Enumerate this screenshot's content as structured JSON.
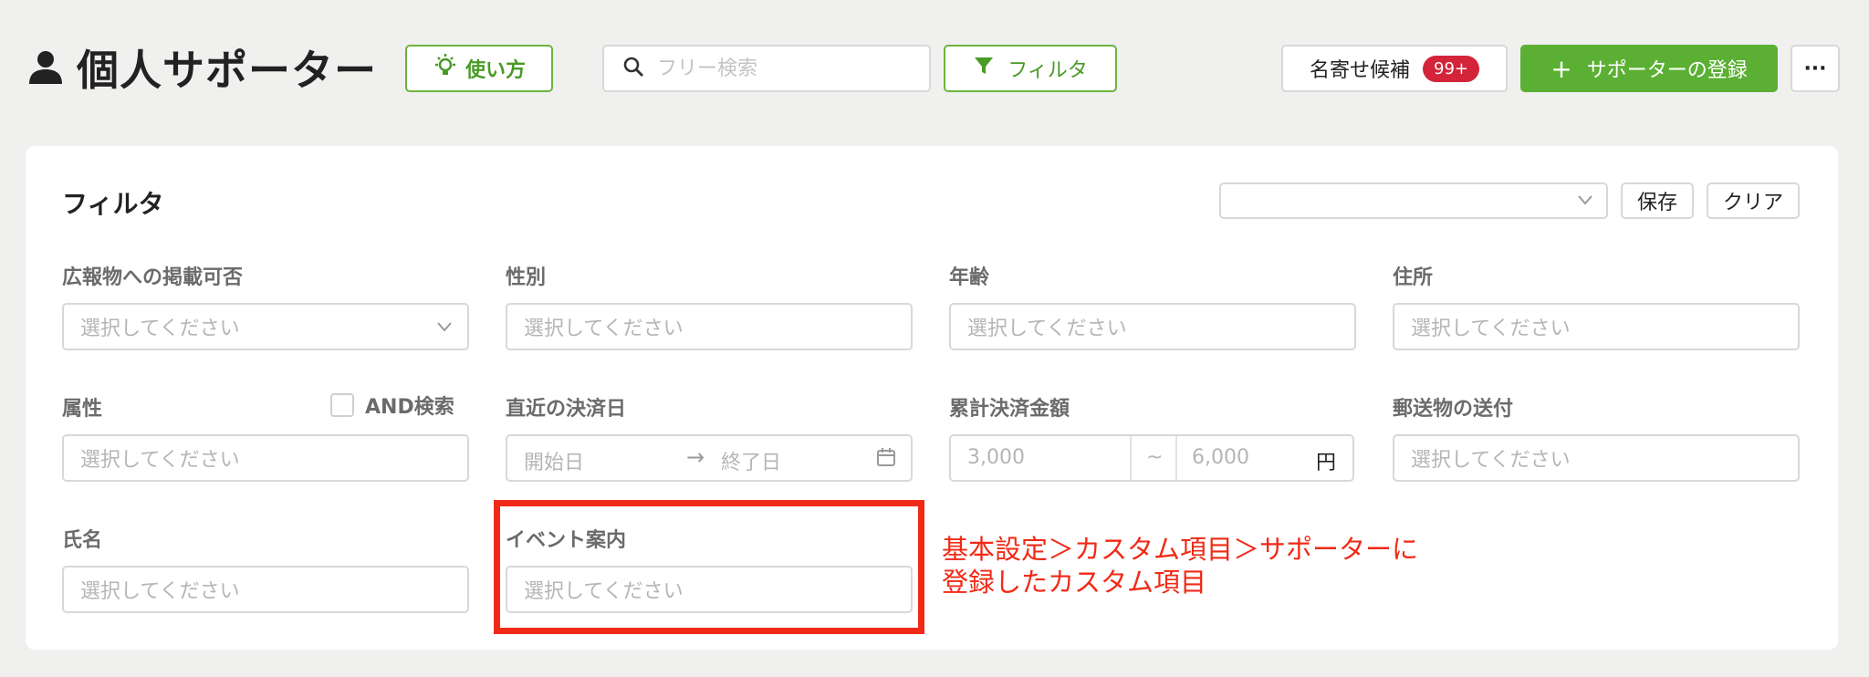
{
  "header": {
    "title": "個人サポーター",
    "howto_label": "使い方",
    "search_placeholder": "フリー検索",
    "filter_label": "フィルタ",
    "dedupe_label": "名寄せ候補",
    "dedupe_badge": "99+",
    "register_label": "サポーターの登録",
    "register_plus": "+",
    "more_label": "···"
  },
  "panel": {
    "title": "フィルタ",
    "preset_value": "",
    "save_label": "保存",
    "clear_label": "クリア"
  },
  "filters": {
    "pr_publish": {
      "label": "広報物への掲載可否",
      "placeholder": "選択してください"
    },
    "gender": {
      "label": "性別",
      "placeholder": "選択してください"
    },
    "age": {
      "label": "年齢",
      "placeholder": "選択してください"
    },
    "address": {
      "label": "住所",
      "placeholder": "選択してください"
    },
    "attribute": {
      "label": "属性",
      "placeholder": "選択してください",
      "and_label": "AND検索",
      "and_checked": false
    },
    "last_payment": {
      "label": "直近の決済日",
      "start_placeholder": "開始日",
      "arrow": "→",
      "end_placeholder": "終了日"
    },
    "total_amount": {
      "label": "累計決済金額",
      "min_placeholder": "3,000",
      "separator": "~",
      "max_placeholder": "6,000",
      "unit": "円"
    },
    "mail_send": {
      "label": "郵送物の送付",
      "placeholder": "選択してください"
    },
    "name": {
      "label": "氏名",
      "placeholder": "選択してください"
    },
    "event_info": {
      "label": "イベント案内",
      "placeholder": "選択してください"
    }
  },
  "annotation": {
    "line1": "基本設定＞カスタム項目＞サポーターに",
    "line2": "登録したカスタム項目"
  },
  "colors": {
    "accent_green": "#5bb033",
    "badge_red": "#d3243a",
    "annotation_red": "#f02a17"
  }
}
